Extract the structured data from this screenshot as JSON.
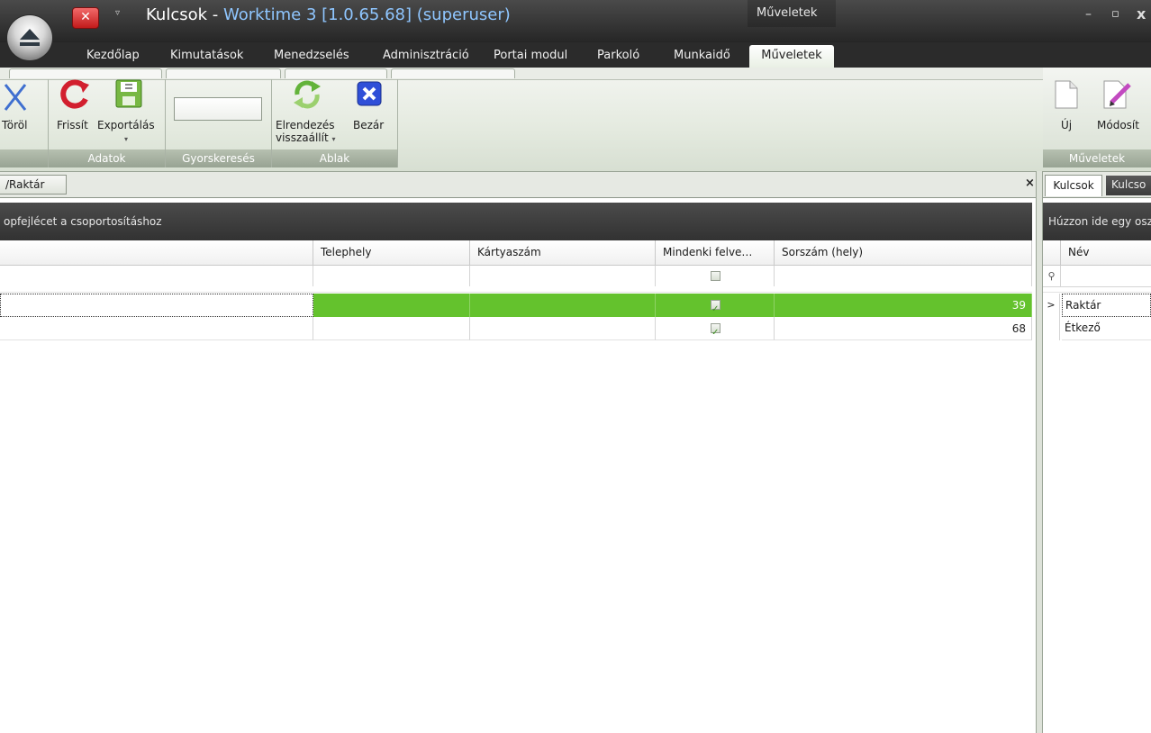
{
  "window": {
    "title_prefix": "Kulcsok - ",
    "title_app": "Worktime 3",
    "title_suffix": " [1.0.65.68] (superuser)",
    "context_tab_group": "Műveletek",
    "minimize": "–",
    "maximize": "▫",
    "close": "x"
  },
  "quick_access": {
    "close_glyph": "✕",
    "dropdown_glyph": "▿"
  },
  "ribbon_tabs": [
    "Kezdőlap",
    "Kimutatások",
    "Menedzselés",
    "Adminisztráció",
    "Portai modul",
    "Parkoló",
    "Munkaidő",
    "Műveletek"
  ],
  "active_tab": "Műveletek",
  "ribbon": {
    "buttons": {
      "torol": "Töröl",
      "frissit": "Frissít",
      "exportalas": "Exportálás",
      "elrendezes": "Elrendezés",
      "visszaallit": "visszaállít",
      "bezar": "Bezár",
      "uj": "Új",
      "modosit": "Módosít"
    },
    "dropdown_arrow": "▾",
    "groups": {
      "adatok": "Adatok",
      "gyorskereses": "Gyorskeresés",
      "ablak": "Ablak",
      "muveletek": "Műveletek"
    },
    "search_value": ""
  },
  "document_tab": {
    "label": "/Raktár",
    "close": "×"
  },
  "main_grid": {
    "group_panel_text": "opfejlécet a csoportosításhoz",
    "columns": [
      "",
      "Telephely",
      "Kártyaszám",
      "Mindenki felve…",
      "Sorszám (hely)"
    ],
    "rows": [
      {
        "name": "",
        "telephely": "",
        "kartyaszam": "",
        "mindenki": true,
        "sorszam": "39",
        "selected": true
      },
      {
        "name": "",
        "telephely": "",
        "kartyaszam": "",
        "mindenki": true,
        "sorszam": "68",
        "selected": false
      }
    ],
    "accent_color": "#64c22d"
  },
  "right_panel": {
    "tabs": [
      "Kulcsok",
      "Kulcso"
    ],
    "group_panel_text": "Húzzon ide egy osz",
    "column": "Név",
    "filter_icon": "⚲",
    "row_indicator": ">",
    "rows": [
      "Raktár",
      "Étkező"
    ]
  }
}
